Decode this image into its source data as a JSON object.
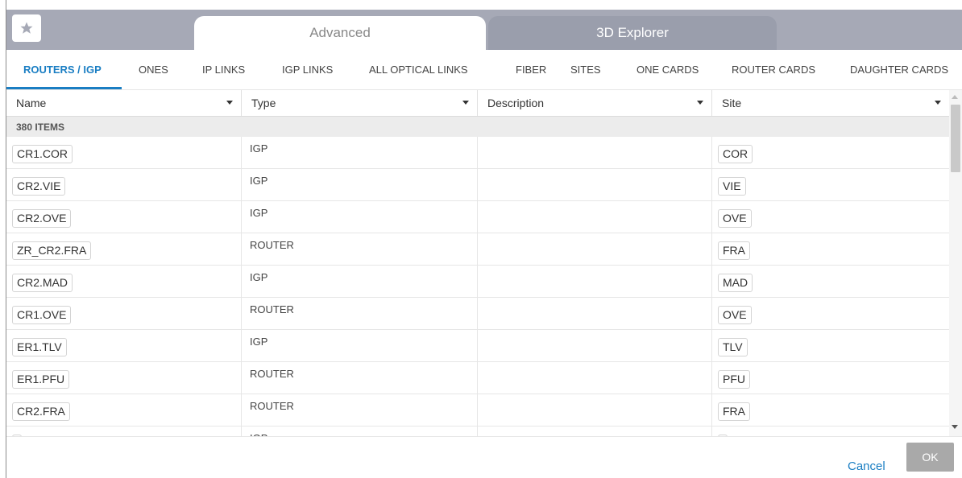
{
  "main_tabs": [
    {
      "label": "Advanced",
      "active": true
    },
    {
      "label": "3D Explorer",
      "active": false
    }
  ],
  "icons": {
    "favorite": "star-icon"
  },
  "sub_tabs": [
    {
      "label": "ROUTERS / IGP",
      "active": true
    },
    {
      "label": "ONES"
    },
    {
      "label": "IP LINKS"
    },
    {
      "label": "IGP LINKS"
    },
    {
      "label": "ALL OPTICAL LINKS"
    },
    {
      "label": "FIBER"
    },
    {
      "label": "SITES"
    },
    {
      "label": "ONE CARDS"
    },
    {
      "label": "ROUTER CARDS"
    },
    {
      "label": "DAUGHTER CARDS"
    }
  ],
  "table": {
    "columns": [
      "Name",
      "Type",
      "Description",
      "Site"
    ],
    "group_label": "380 ITEMS",
    "rows": [
      {
        "name": "CR1.COR",
        "type": "IGP",
        "description": "",
        "site": "COR"
      },
      {
        "name": "CR2.VIE",
        "type": "IGP",
        "description": "",
        "site": "VIE"
      },
      {
        "name": "CR2.OVE",
        "type": "IGP",
        "description": "",
        "site": "OVE"
      },
      {
        "name": "ZR_CR2.FRA",
        "type": "ROUTER",
        "description": "",
        "site": "FRA"
      },
      {
        "name": "CR2.MAD",
        "type": "IGP",
        "description": "",
        "site": "MAD"
      },
      {
        "name": "CR1.OVE",
        "type": "ROUTER",
        "description": "",
        "site": "OVE"
      },
      {
        "name": "ER1.TLV",
        "type": "IGP",
        "description": "",
        "site": "TLV"
      },
      {
        "name": "ER1.PFU",
        "type": "ROUTER",
        "description": "",
        "site": "PFU"
      },
      {
        "name": "CR2.FRA",
        "type": "ROUTER",
        "description": "",
        "site": "FRA"
      },
      {
        "name": "",
        "type": "IGP",
        "description": "",
        "site": ""
      }
    ]
  },
  "footer": {
    "cancel_label": "Cancel",
    "ok_label": "OK"
  },
  "colors": {
    "accent": "#1a7ec3",
    "header_band": "#a6a9b6",
    "ok_button": "#a9a9a9"
  }
}
